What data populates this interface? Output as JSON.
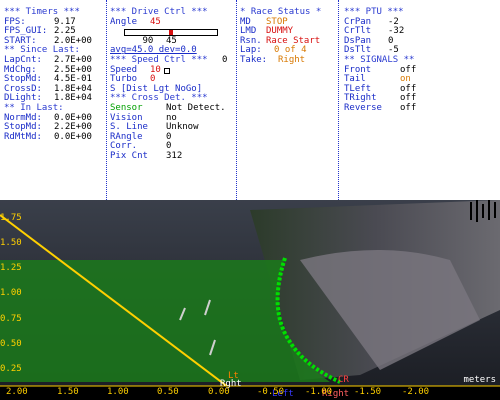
{
  "timers": {
    "header": "*** Timers ***",
    "rows": [
      {
        "label": "FPS:",
        "value": "9.17"
      },
      {
        "label": "FPS_GUI:",
        "value": "2.25"
      },
      {
        "label": "START:",
        "value": "2.0E+00"
      }
    ],
    "since_header": "** Since Last:",
    "since_rows": [
      {
        "label": "LapCnt:",
        "value": "2.7E+00"
      },
      {
        "label": "MdChg:",
        "value": "2.5E+00"
      },
      {
        "label": "StopMd:",
        "value": "4.5E-01"
      },
      {
        "label": "CrossD:",
        "value": "1.8E+04"
      },
      {
        "label": "DLight:",
        "value": "1.8E+04"
      }
    ],
    "in_header": "** In Last:",
    "in_rows": [
      {
        "label": "NormMd:",
        "value": "0.0E+00"
      },
      {
        "label": "StopMd:",
        "value": "2.2E+00"
      },
      {
        "label": "RdMtMd:",
        "value": "0.0E+00"
      }
    ]
  },
  "drive": {
    "header": "*** Drive Ctrl ***",
    "angle_label": "Angle",
    "angle_value": "45",
    "slider_min": "90",
    "slider_max": "0",
    "slider_value": "45",
    "slider_fraction": 0.5,
    "avg_dev": "avg=45.0 dev=0.0",
    "speed_header": "*** Speed Ctrl ***",
    "speed_label": "Speed",
    "speed_value": "10",
    "turbo_label": "Turbo",
    "turbo_value": "0",
    "dist_line": "S [Dist Lgt NoGo]",
    "cross_header": "*** Cross Det. ***",
    "cross_rows": [
      {
        "label": "Sensor",
        "value": "Not Detect."
      },
      {
        "label": "Vision",
        "value": "no"
      },
      {
        "label": "S. Line",
        "value": "Unknow"
      },
      {
        "label": "RAngle",
        "value": "0"
      },
      {
        "label": "Corr.",
        "value": "0"
      },
      {
        "label": "Pix Cnt",
        "value": "312"
      }
    ]
  },
  "race": {
    "header": "* Race Status *",
    "md_label": "MD",
    "md_value": "STOP",
    "lmd_label": "LMD",
    "lmd_value": "DUMMY",
    "rsn_label": "Rsn.",
    "rsn_value": "Race Start",
    "lap_label": "Lap:",
    "lap_value": "0 of 4",
    "take_label": "Take:",
    "take_value": "Right"
  },
  "ptu": {
    "header": "*** PTU ***",
    "rows": [
      {
        "label": "CrPan",
        "value": "-2"
      },
      {
        "label": "CrTlt",
        "value": "-32"
      },
      {
        "label": "DsPan",
        "value": "0"
      },
      {
        "label": "DsTlt",
        "value": "-5"
      }
    ],
    "signals_header": "** SIGNALS **",
    "signals": [
      {
        "label": "Front",
        "value": "off"
      },
      {
        "label": "Tail",
        "value": "on"
      },
      {
        "label": "TLeft",
        "value": "off"
      },
      {
        "label": "TRight",
        "value": "off"
      },
      {
        "label": "Reverse",
        "value": "off"
      }
    ]
  },
  "view": {
    "y_labels": [
      "1.75",
      "1.50",
      "1.25",
      "1.00",
      "0.75",
      "0.50",
      "0.25"
    ],
    "x_labels": [
      "2.00",
      "1.50",
      "1.00",
      "0.50",
      "0.00",
      "-0.50",
      "-1.00",
      "-1.50",
      "-2.00"
    ],
    "units": "meters",
    "markers": [
      "Left",
      "Right",
      "Rght",
      "Lt",
      "CR"
    ]
  },
  "colors": {
    "header_blue": "#2a3ad0",
    "label_blue": "#1a2cc8",
    "red": "#d81010",
    "orange": "#d87800",
    "green": "#00a000",
    "axis_yellow": "#ffd000",
    "lane_green": "#00e000"
  }
}
